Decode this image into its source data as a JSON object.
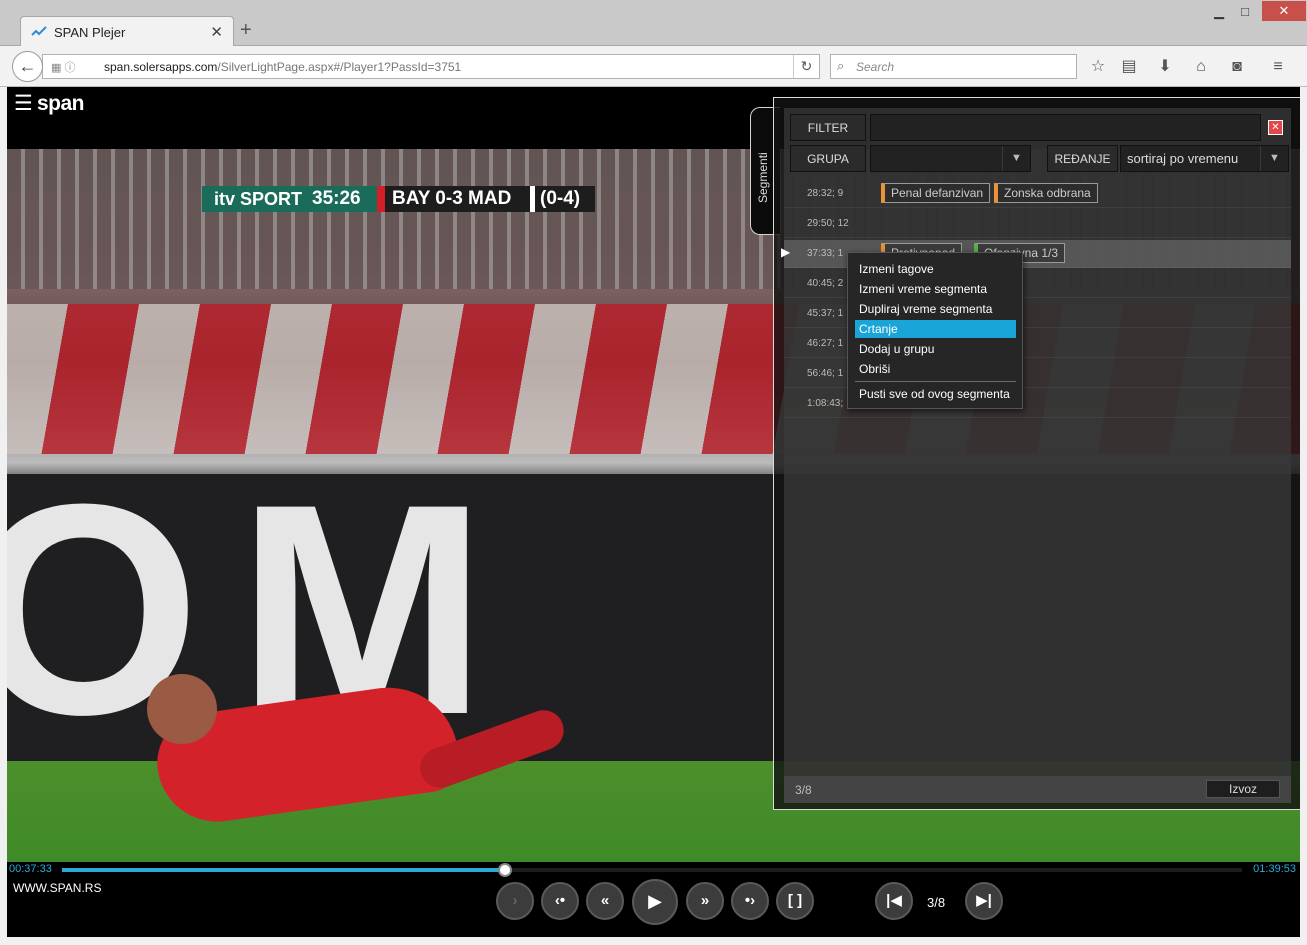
{
  "browser": {
    "tab_title": "SPAN Plejer",
    "new_tab": "+",
    "url_host": "span.solersapps.com",
    "url_path": "/SilverLightPage.aspx#/Player1?PassId=3751",
    "search_placeholder": "Search",
    "window_controls": {
      "minimize": "▁",
      "maximize": "□",
      "close": "✕"
    }
  },
  "player": {
    "logo": "span",
    "scorebug": {
      "brand": "itv SPORT",
      "clock": "35:26",
      "score": "BAY 0-3 MAD",
      "aggregate": "(0-4)"
    },
    "site_url": "WWW.SPAN.RS",
    "time_current": "00:37:33",
    "time_total": "01:39:53",
    "progress_fraction": 0.375,
    "segment_position": "3/8"
  },
  "segments_panel": {
    "tab_label": "Segmenti",
    "filter_label": "FILTER",
    "filter_value": "",
    "group_label": "GRUPA",
    "group_value": "",
    "sort_label": "REĐANJE",
    "sort_value": "sortiraj po vremenu",
    "rows": [
      {
        "time": "28:32; 9",
        "tags": [
          {
            "text": "Penal defanzivan",
            "color": "#e8923a"
          },
          {
            "text": "Zonska odbrana",
            "color": "#e8923a"
          }
        ]
      },
      {
        "time": "29:50; 12",
        "tags": []
      },
      {
        "time": "37:33; 1",
        "tags": [
          {
            "text": "Protivnapad",
            "color": "#e8923a"
          },
          {
            "text": "Ofanzivna 1/3",
            "color": "#5ab04a"
          }
        ],
        "active": true
      },
      {
        "time": "40:45; 2",
        "tags": []
      },
      {
        "time": "45:37; 1",
        "tags": []
      },
      {
        "time": "46:27; 1",
        "tags": []
      },
      {
        "time": "56:46; 1",
        "tags": []
      },
      {
        "time": "1:08:43;",
        "tags": []
      }
    ],
    "count": "3/8",
    "export_label": "Izvoz"
  },
  "context_menu": {
    "items": [
      "Izmeni tagove",
      "Izmeni vreme segmenta",
      "Dupliraj vreme segmenta",
      "Crtanje",
      "Dodaj u grupu",
      "Obriši",
      "Pusti sve od ovog segmenta"
    ],
    "highlighted": "Crtanje"
  },
  "colors": {
    "accent": "#2ba9d8",
    "menu_highlight": "#1aa5d8",
    "tag_orange": "#e8923a",
    "tag_green": "#5ab04a",
    "close_red": "#e24848"
  },
  "icons": {
    "tab": "activity-icon",
    "back": "back-arrow-icon",
    "reload": "reload-icon",
    "search": "search-icon",
    "bookmark": "star-icon",
    "reading_list": "reading-list-icon",
    "download": "download-icon",
    "home": "home-icon",
    "pocket": "pocket-icon",
    "menu": "hamburger-icon"
  }
}
